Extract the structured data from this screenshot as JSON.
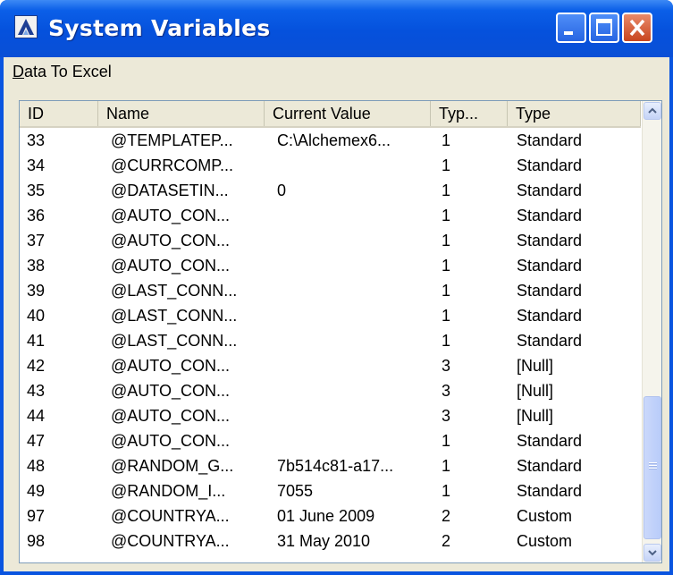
{
  "window": {
    "title": "System Variables"
  },
  "menu": {
    "data_to_excel_mnemonic": "D",
    "data_to_excel_rest": "ata To Excel"
  },
  "table": {
    "columns": [
      "ID",
      "Name",
      "Current Value",
      "Typ...",
      "Type"
    ],
    "rows": [
      [
        "33",
        "@TEMPLATEP...",
        "C:\\Alchemex6...",
        "1",
        "Standard"
      ],
      [
        "34",
        "@CURRCOMP...",
        "",
        "1",
        "Standard"
      ],
      [
        "35",
        "@DATASETIN...",
        "0",
        "1",
        "Standard"
      ],
      [
        "36",
        "@AUTO_CON...",
        "",
        "1",
        "Standard"
      ],
      [
        "37",
        "@AUTO_CON...",
        "",
        "1",
        "Standard"
      ],
      [
        "38",
        "@AUTO_CON...",
        "",
        "1",
        "Standard"
      ],
      [
        "39",
        "@LAST_CONN...",
        "",
        "1",
        "Standard"
      ],
      [
        "40",
        "@LAST_CONN...",
        "",
        "1",
        "Standard"
      ],
      [
        "41",
        "@LAST_CONN...",
        "",
        "1",
        "Standard"
      ],
      [
        "42",
        "@AUTO_CON...",
        "",
        "3",
        "[Null]"
      ],
      [
        "43",
        "@AUTO_CON...",
        "",
        "3",
        "[Null]"
      ],
      [
        "44",
        "@AUTO_CON...",
        "",
        "3",
        "[Null]"
      ],
      [
        "47",
        "@AUTO_CON...",
        "",
        "1",
        "Standard"
      ],
      [
        "48",
        "@RANDOM_G...",
        "7b514c81-a17...",
        "1",
        "Standard"
      ],
      [
        "49",
        "@RANDOM_I...",
        "7055",
        "1",
        "Standard"
      ],
      [
        "97",
        "@COUNTRYA...",
        "01 June 2009",
        "2",
        "Custom"
      ],
      [
        "98",
        "@COUNTRYA...",
        "31 May 2010",
        "2",
        "Custom"
      ]
    ]
  },
  "icons": {
    "app": "app-logo-icon",
    "minimize": "minimize-icon",
    "maximize": "maximize-icon",
    "close": "close-icon",
    "scroll_up": "chevron-up-icon",
    "scroll_down": "chevron-down-icon"
  },
  "colors": {
    "titlebar": "#0551dc",
    "close_button": "#c8451e",
    "menubar": "#ece9d8"
  }
}
